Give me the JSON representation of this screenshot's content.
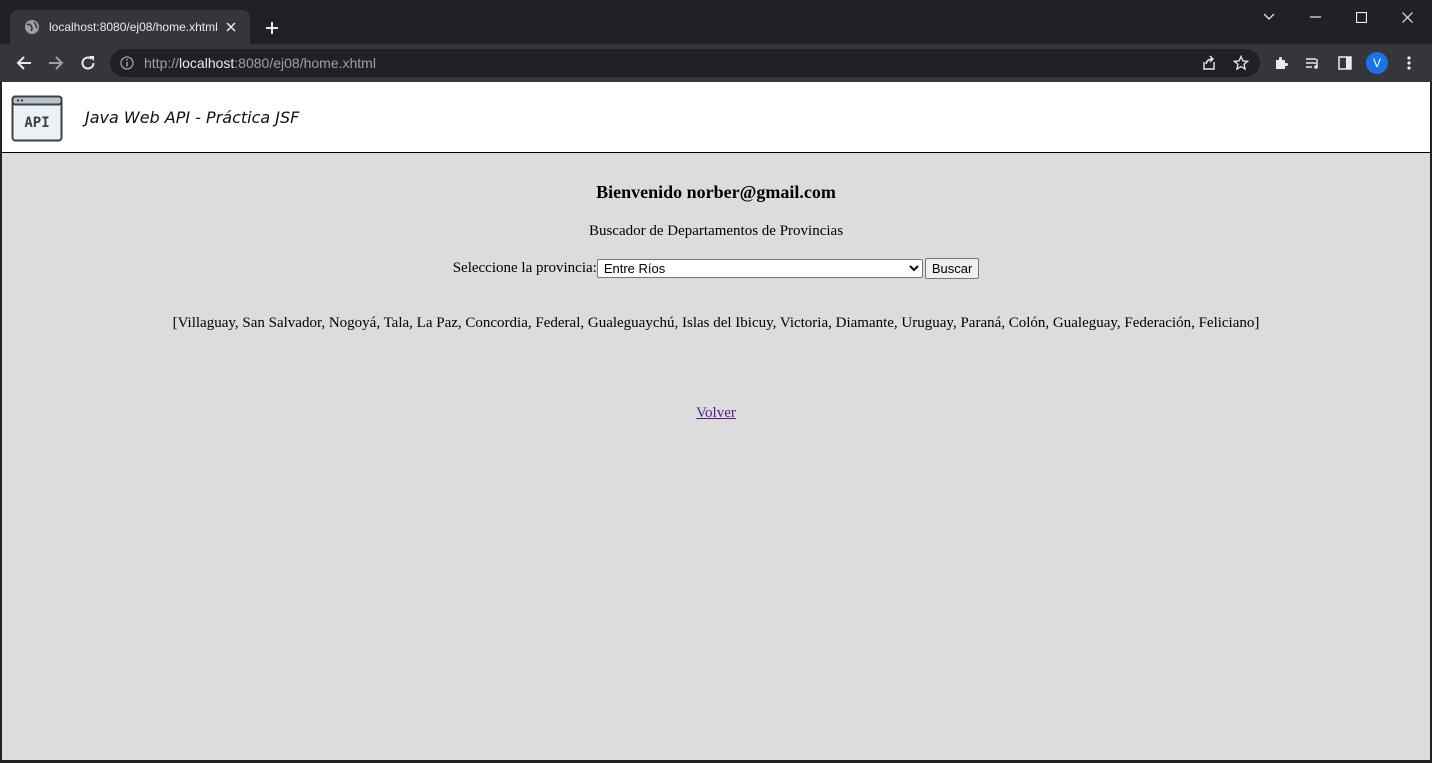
{
  "browser": {
    "tab_title": "localhost:8080/ej08/home.xhtml",
    "url_scheme": "http://",
    "url_host": "localhost",
    "url_rest": ":8080/ej08/home.xhtml",
    "profile_initial": "V"
  },
  "header": {
    "logo_text": "API",
    "title": "Java Web API - Práctica JSF"
  },
  "main": {
    "welcome": "Bienvenido norber@gmail.com",
    "subtitle": "Buscador de Departamentos de Provincias",
    "province_label": "Seleccione la provincia:",
    "province_selected": "Entre Ríos",
    "search_button": "Buscar",
    "result": "[Villaguay, San Salvador, Nogoyá, Tala, La Paz, Concordia, Federal, Gualeguaychú, Islas del Ibicuy, Victoria, Diamante, Uruguay, Paraná, Colón, Gualeguay, Federación, Feliciano]",
    "back_link": "Volver"
  },
  "colors": {
    "page_bg": "#dcdcdc",
    "header_bg": "#ffffff",
    "visited_link": "#551a8b",
    "chrome_dark": "#202124",
    "chrome_toolbar": "#35363a"
  }
}
